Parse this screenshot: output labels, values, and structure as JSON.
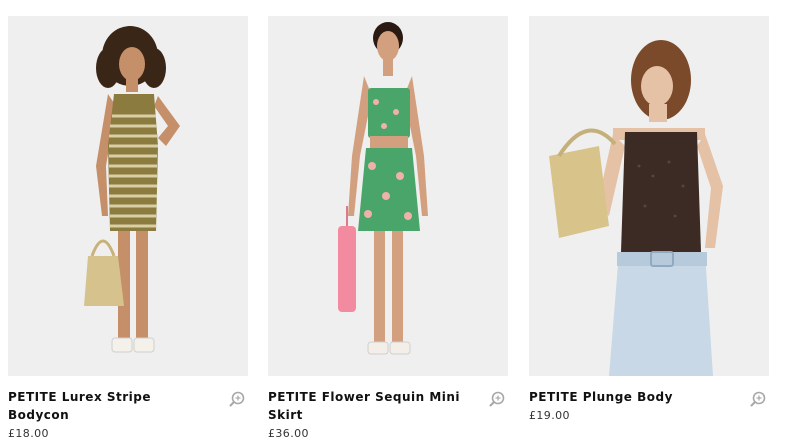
{
  "products": [
    {
      "title": "PETITE Lurex Stripe Bodycon",
      "price": "£18.00",
      "image_alt": "Model wearing striped bodycon dress",
      "quick_view_icon": "quick-view-magnifier-icon"
    },
    {
      "title": "PETITE Flower Sequin Mini Skirt",
      "price": "£36.00",
      "image_alt": "Model wearing green floral sequin co-ord",
      "quick_view_icon": "quick-view-magnifier-icon"
    },
    {
      "title": "PETITE Plunge Body",
      "price": "£19.00",
      "image_alt": "Model wearing brown plunge body with light jeans",
      "quick_view_icon": "quick-view-magnifier-icon"
    }
  ],
  "colors": {
    "photo_background": "#efefef",
    "title_text": "#111111",
    "price_text": "#333333",
    "icon": "#a8a8a8"
  }
}
